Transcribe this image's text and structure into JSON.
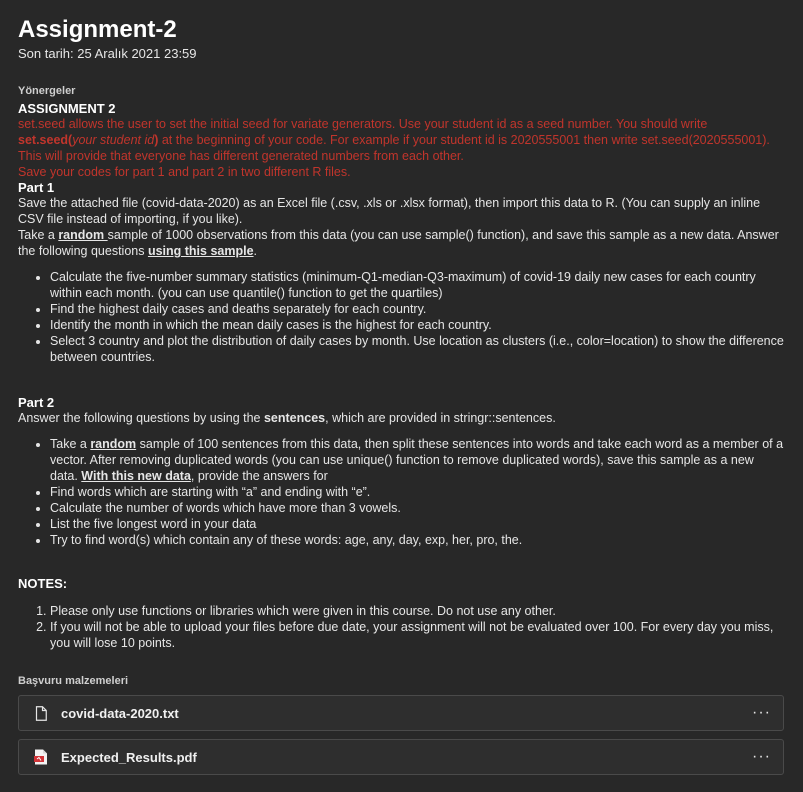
{
  "header": {
    "title": "Assignment-2",
    "due_date": "Son tarih: 25 Aralık 2021 23:59"
  },
  "instructions": {
    "label": "Yönergeler",
    "assignment_title": "ASSIGNMENT 2",
    "red_notice": {
      "line1": "set.seed allows the user to set the initial seed for variate generators. Use your student id as a seed number. You should write ",
      "setseed": "set.seed(",
      "student_id": "your student id",
      "close": ")",
      "line1_end": " at the beginning of your code. For example if your student id is 2020555001 then write set.seed(2020555001). This will provide that everyone has different generated numbers from each other.",
      "line2": "Save your codes for part 1 and part 2 in two different R files."
    },
    "part1": {
      "title": "Part 1",
      "p1": "Save the attached file (covid-data-2020) as an Excel file (.csv, .xls or .xlsx format), then import this data to R. (You can supply an inline CSV file instead of importing, if you like).",
      "p2_a": "Take a ",
      "p2_random": "random ",
      "p2_b": "sample of 1000 observations from this data (you can use sample() function), and save this sample as a new data. Answer the following questions ",
      "p2_using": "using this sample",
      "p2_c": ".",
      "bullets": [
        "Calculate the five-number summary statistics (minimum-Q1-median-Q3-maximum) of covid-19 daily new cases for each country within each month. (you can use quantile() function to get the quartiles)",
        "Find the highest daily cases and deaths separately for each country.",
        "Identify the month in which the mean daily cases is the highest for each country.",
        "Select 3 country and plot the distribution of daily cases by month. Use location as clusters (i.e., color=location) to show the difference between countries."
      ]
    },
    "part2": {
      "title": "Part 2",
      "intro_a": "Answer the following questions by using the ",
      "intro_sentences": "sentences",
      "intro_b": ", which are provided in stringr::sentences.",
      "b1_a": "Take a ",
      "b1_random": "random",
      "b1_b": " sample of 100 sentences from this data, then split these sentences into words and take each word as a member of a vector. After removing duplicated words (you can use unique() function to remove duplicated words), save this sample as a new data. ",
      "b1_new": "With this new data",
      "b1_c": ", provide the answers for",
      "bullets": [
        "Find words which are starting with “a” and ending with “e”.",
        "Calculate the number of words which have more than 3 vowels.",
        "List the five longest word in your data",
        "Try to find word(s) which contain any of these words: age, any, day, exp, her, pro, the."
      ]
    },
    "notes": {
      "title": "NOTES:",
      "items": [
        "Please only use functions or libraries which were given in this course. Do not use any other.",
        "If you will not be able to upload your files before due date, your assignment will not be evaluated over 100. For every day you miss, you will lose 10 points."
      ]
    }
  },
  "references": {
    "label": "Başvuru malzemeleri",
    "files": [
      {
        "name": "covid-data-2020.txt",
        "icon": "document-icon"
      },
      {
        "name": "Expected_Results.pdf",
        "icon": "pdf-icon"
      }
    ],
    "more_label": "···"
  },
  "colors": {
    "background": "#282828",
    "red_text": "#c1352c",
    "pdf_red": "#d13438"
  }
}
